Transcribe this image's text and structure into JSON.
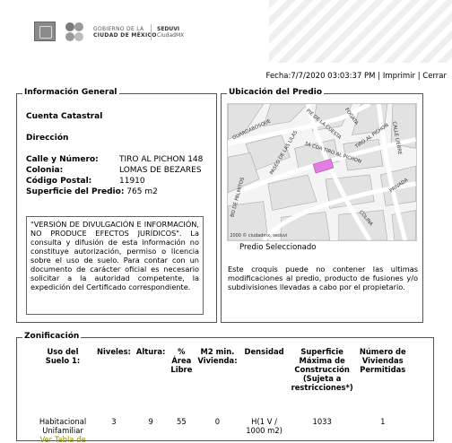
{
  "header": {
    "gov_line1": "GOBIERNO DE LA",
    "gov_line2": "CIUDAD DE MÉXICO",
    "agency": "SEDUVI",
    "agency_sub": "CiudadMX"
  },
  "topbar": {
    "fecha": "Fecha:7/7/2020 03:03:37 PM",
    "sep": "|",
    "imprimir": "Imprimir",
    "cerrar": "Cerrar"
  },
  "info": {
    "legend": "Información General",
    "cuenta_label": "Cuenta Catastral",
    "direccion_label": "Dirección",
    "calle_label": "Calle y Número:",
    "calle_value": "TIRO AL PICHON 148",
    "colonia_label": "Colonia:",
    "colonia_value": "LOMAS DE BEZARES",
    "cp_label": "Código Postal:",
    "cp_value": "11910",
    "sup_label": "Superficie del Predio:",
    "sup_value": "765 m2",
    "disclaimer": "\"VERSIÓN DE DIVULGACIÓN E INFORMACIÓN, NO PRODUCE EFECTOS JURÍDICOS\". La consulta y difusión de esta información no constituye autorización, permiso o licencia sobre el uso de suelo. Para contar con un documento de carácter oficial es necesario solicitar a la autoridad competente, la expedición del Certificado correspondiente."
  },
  "ubicacion": {
    "legend": "Ubicación del Predio",
    "caption": "Predio Seleccionado",
    "note": "Este croquis puede no contener las ultimas modificaciones al predio, producto de fusiones y/o subdivisiones llevadas a cabo por el propietario.",
    "map_streets": [
      "PIE DE LA CUESTA",
      "FOGATA",
      "PASEO DE LAS LILAS",
      "TIRO AL PICHON",
      "3A CDA TIRO AL PICHON",
      "CALLE LIEBRE",
      "GUARDABOSQUE",
      "BO DE PALMITOS",
      "PRIVADA",
      "COLINA"
    ],
    "map_credit": "2000 © ciudadmx, seduvi",
    "parcel_color": "#e07fe0"
  },
  "zonificacion": {
    "legend": "Zonificación",
    "headers": [
      "Uso del Suelo 1:",
      "Niveles:",
      "Altura:",
      "% Área Libre",
      "M2 min. Vivienda:",
      "Densidad",
      "Superficie Máxima de Construcción (Sujeta a restricciones*)",
      "Número de Viviendas Permitidas"
    ],
    "row": [
      "Habitacional Unifamiliar",
      "3",
      "9",
      "55",
      "0",
      "H(1 V / 1000 m2)",
      "1033",
      "1"
    ],
    "link": "Ver Tabla de Uso"
  }
}
